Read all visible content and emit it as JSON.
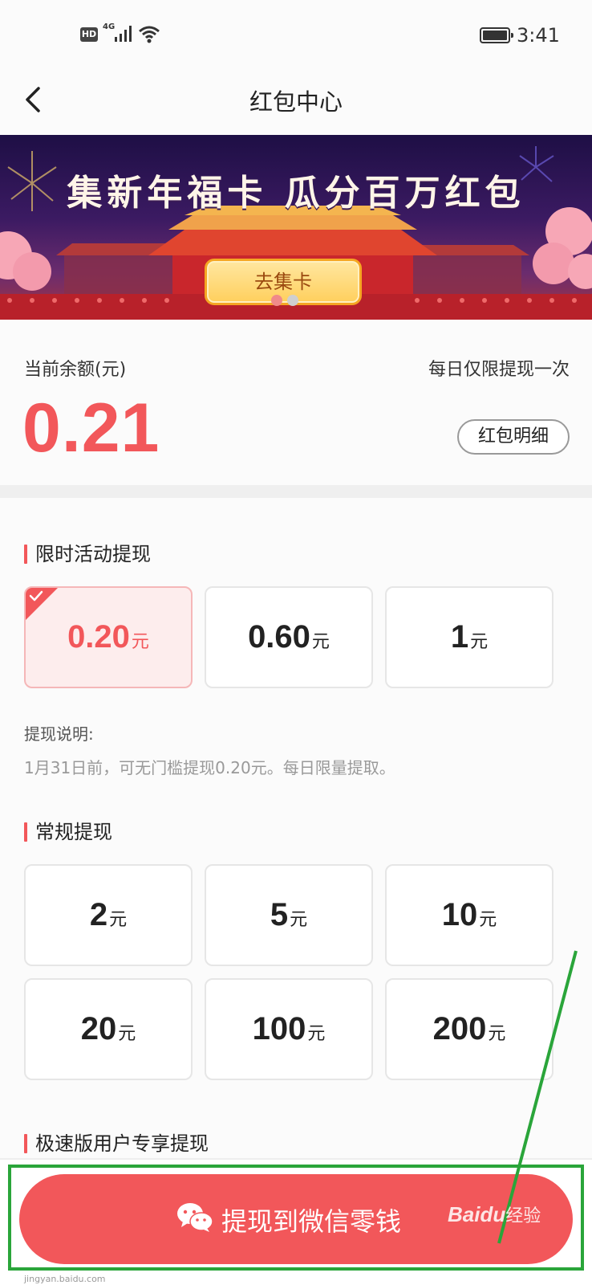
{
  "status_bar": {
    "hd_badge": "HD",
    "network": "4G",
    "time": "3:41"
  },
  "header": {
    "title": "红包中心",
    "back_icon": "chevron-left-icon"
  },
  "banner": {
    "title": "集新年福卡  瓜分百万红包",
    "button_label": "去集卡",
    "dots": [
      {
        "active": true,
        "color": "#f08a8a"
      },
      {
        "active": false,
        "color": "#cfcfcf"
      }
    ]
  },
  "balance": {
    "label": "当前余额(元)",
    "value": "0.21",
    "limit_note": "每日仅限提现一次",
    "detail_button": "红包明细"
  },
  "limited_withdraw": {
    "heading": "限时活动提现",
    "options": [
      {
        "amount": "0.20",
        "unit": "元",
        "selected": true
      },
      {
        "amount": "0.60",
        "unit": "元",
        "selected": false
      },
      {
        "amount": "1",
        "unit": "元",
        "selected": false
      }
    ],
    "note_title": "提现说明:",
    "note_text": "1月31日前，可无门槛提现0.20元。每日限量提取。"
  },
  "regular_withdraw": {
    "heading": "常规提现",
    "options": [
      {
        "amount": "2",
        "unit": "元"
      },
      {
        "amount": "5",
        "unit": "元"
      },
      {
        "amount": "10",
        "unit": "元"
      },
      {
        "amount": "20",
        "unit": "元"
      },
      {
        "amount": "100",
        "unit": "元"
      },
      {
        "amount": "200",
        "unit": "元"
      }
    ]
  },
  "express_withdraw": {
    "heading": "极速版用户专享提现"
  },
  "action": {
    "button_label": "提现到微信零钱",
    "icon": "wechat-icon"
  },
  "watermark": {
    "brand": "Bai",
    "brand_suffix": "du",
    "text": "经验",
    "url": "jingyan.baidu.com"
  },
  "colors": {
    "accent": "#f2575a",
    "annotation": "#2aa53a"
  }
}
